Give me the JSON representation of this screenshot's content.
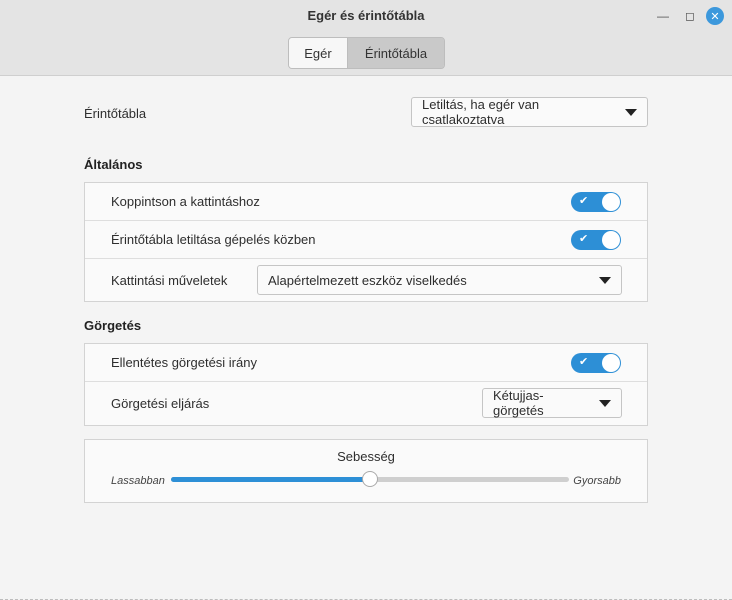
{
  "window": {
    "title": "Egér és érintőtábla"
  },
  "tabs": [
    {
      "label": "Egér",
      "active": false
    },
    {
      "label": "Érintőtábla",
      "active": true
    }
  ],
  "touchpad": {
    "label": "Érintőtábla",
    "value": "Letiltás, ha egér van csatlakoztatva"
  },
  "general": {
    "title": "Általános",
    "tap_to_click": {
      "label": "Koppintson a kattintáshoz",
      "on": true
    },
    "disable_while_typing": {
      "label": "Érintőtábla letiltása gépelés közben",
      "on": true
    },
    "click_actions": {
      "label": "Kattintási műveletek",
      "value": "Alapértelmezett eszköz viselkedés"
    }
  },
  "scrolling": {
    "title": "Görgetés",
    "natural_scroll": {
      "label": "Ellentétes görgetési irány",
      "on": true
    },
    "method": {
      "label": "Görgetési eljárás",
      "value": "Kétujjas-görgetés"
    }
  },
  "speed": {
    "title": "Sebesség",
    "low_label": "Lassabban",
    "high_label": "Gyorsabb",
    "value": 0.5
  },
  "colors": {
    "accent": "#2d8fd6",
    "close": "#3c98dc"
  },
  "icons": [
    "minimize-icon",
    "maximize-icon",
    "close-icon",
    "check-icon",
    "caret-down-icon"
  ]
}
